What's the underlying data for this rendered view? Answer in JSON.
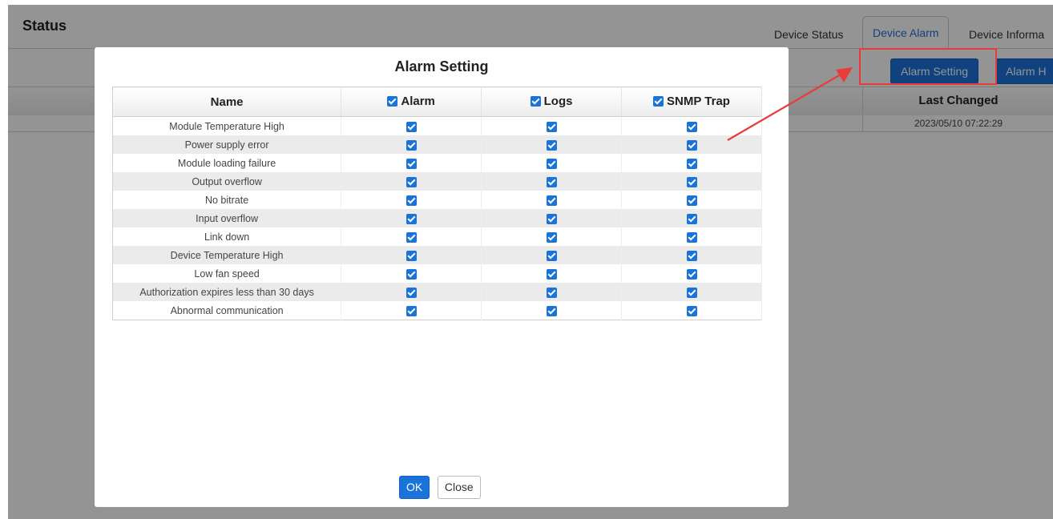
{
  "page": {
    "title": "Status"
  },
  "tabs": [
    {
      "label": "Device Status"
    },
    {
      "label": "Device Alarm"
    },
    {
      "label": "Device Informa"
    }
  ],
  "toolbar": {
    "alarm_setting": "Alarm Setting",
    "alarm_history": "Alarm H"
  },
  "background_table": {
    "header": "Last Changed",
    "rows": [
      "2023/05/10 07:22:29"
    ]
  },
  "modal": {
    "title": "Alarm Setting",
    "columns": [
      "Name",
      "Alarm",
      "Logs",
      "SNMP Trap"
    ],
    "rows": [
      {
        "name": "Module Temperature High",
        "alarm": true,
        "logs": true,
        "snmp": true
      },
      {
        "name": "Power supply error",
        "alarm": true,
        "logs": true,
        "snmp": true
      },
      {
        "name": "Module loading failure",
        "alarm": true,
        "logs": true,
        "snmp": true
      },
      {
        "name": "Output overflow",
        "alarm": true,
        "logs": true,
        "snmp": true
      },
      {
        "name": "No bitrate",
        "alarm": true,
        "logs": true,
        "snmp": true
      },
      {
        "name": "Input overflow",
        "alarm": true,
        "logs": true,
        "snmp": true
      },
      {
        "name": "Link down",
        "alarm": true,
        "logs": true,
        "snmp": true
      },
      {
        "name": "Device Temperature High",
        "alarm": true,
        "logs": true,
        "snmp": true
      },
      {
        "name": "Low fan speed",
        "alarm": true,
        "logs": true,
        "snmp": true
      },
      {
        "name": "Authorization expires less than 30 days",
        "alarm": true,
        "logs": true,
        "snmp": true
      },
      {
        "name": "Abnormal communication",
        "alarm": true,
        "logs": true,
        "snmp": true
      }
    ],
    "ok_label": "OK",
    "close_label": "Close"
  },
  "colors": {
    "accent": "#1a73d9",
    "annotation": "#ea3b3b"
  }
}
